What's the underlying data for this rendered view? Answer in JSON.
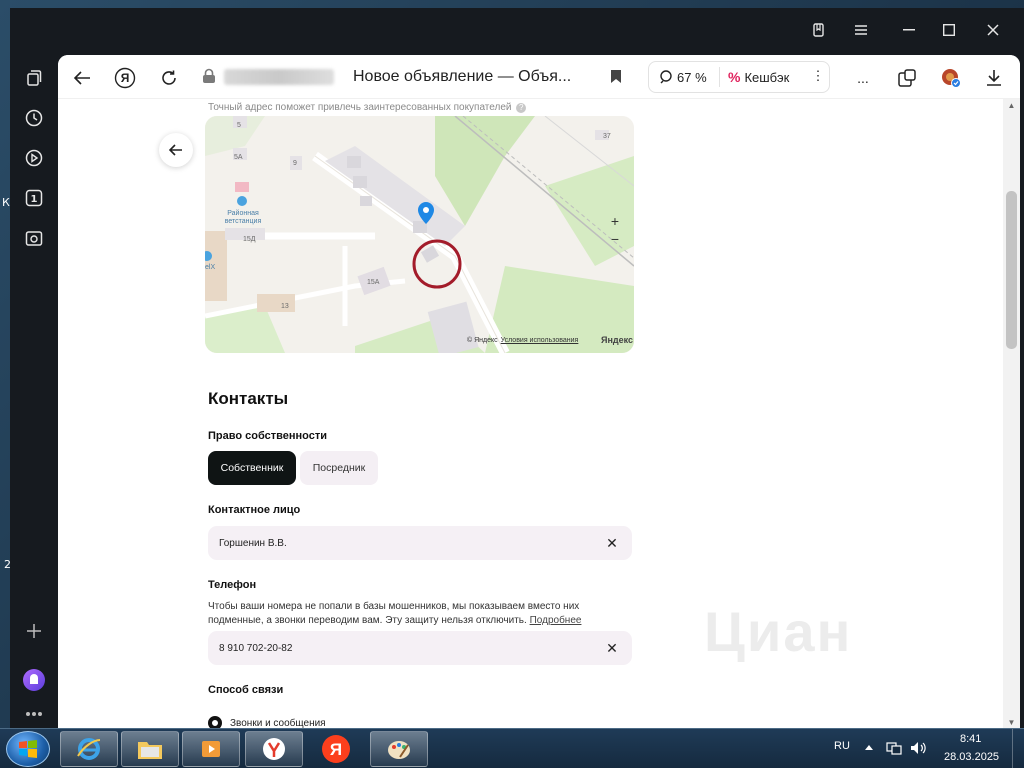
{
  "browser": {
    "tab_title": "Новое объявление — Объя...",
    "zoom": "67 %",
    "cashback": "Кешбэк",
    "yandex_letter": "Я",
    "more_dots": "...",
    "kebab": "⋮"
  },
  "page": {
    "address_hint": "Точный адрес поможет привлечь заинтересованных покупателей",
    "map": {
      "labels": [
        "5",
        "5А",
        "9",
        "Районная ветстанция",
        "15Д",
        "15А",
        "13",
        "37",
        "elX"
      ],
      "credit": "© Яндекс",
      "terms": "Условия использования",
      "brand": "Яндекс",
      "zoom_in": "+",
      "zoom_out": "−"
    },
    "contacts": {
      "title": "Контакты",
      "ownership_label": "Право собственности",
      "ownership_options": [
        "Собственник",
        "Посредник"
      ],
      "ownership_selected": "Собственник",
      "contact_label": "Контактное лицо",
      "contact_value": "Горшенин В.В.",
      "phone_label": "Телефон",
      "phone_desc": "Чтобы ваши номера не попали в базы мошенников, мы показываем вместо них подменные, а звонки переводим вам. Эту защиту нельзя отключить.",
      "phone_desc_link": "Подробнее",
      "phone_value": "8 910 702-20-82",
      "method_label": "Способ связи",
      "method_option": "Звонки и сообщения"
    },
    "watermark": "Циан"
  },
  "taskbar": {
    "lang": "RU",
    "time": "8:41",
    "date": "28.03.2025"
  },
  "desktop": {
    "edge_text_1": "К",
    "edge_text_2": "2"
  },
  "colors": {
    "accent_dark": "#0f1414",
    "field_bg": "#f5f0f5",
    "map_pin": "#1e88e5",
    "annotation_circle": "#a31c2a"
  }
}
